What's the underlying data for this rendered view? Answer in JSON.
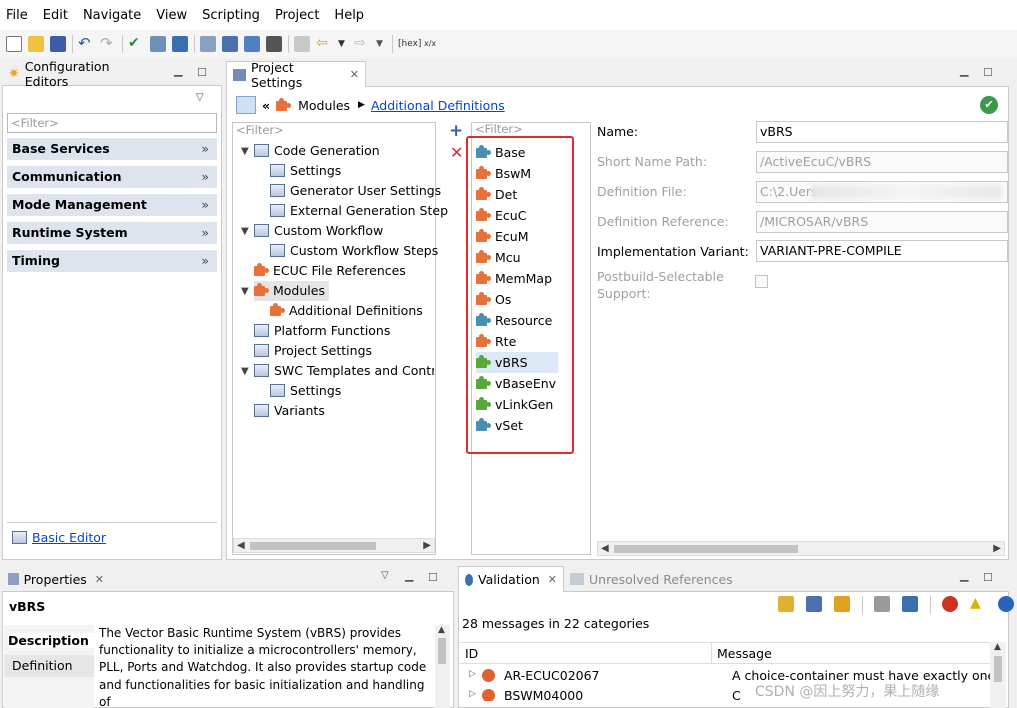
{
  "menu": [
    "File",
    "Edit",
    "Navigate",
    "View",
    "Scripting",
    "Project",
    "Help"
  ],
  "config_editors": {
    "title": "Configuration Editors",
    "filter_placeholder": "<Filter>",
    "categories": [
      "Base Services",
      "Communication",
      "Mode Management",
      "Runtime System",
      "Timing"
    ],
    "basic_editor_link": "Basic Editor"
  },
  "project_settings": {
    "tab_title": "Project Settings",
    "breadcrumb_modules": "Modules",
    "breadcrumb_link": "Additional Definitions",
    "tree_filter": "<Filter>",
    "tree": [
      "Code Generation",
      "Settings",
      "Generator User Settings",
      "External Generation Step",
      "Custom Workflow",
      "Custom Workflow Steps",
      "ECUC File References",
      "Modules",
      "Additional Definitions",
      "Platform Functions",
      "Project Settings",
      "SWC Templates and Contra",
      "Settings",
      "Variants"
    ],
    "modules_filter": "<Filter>",
    "modules": [
      {
        "name": "Base",
        "color": "#4a8fb0"
      },
      {
        "name": "BswM",
        "color": "#e8703a"
      },
      {
        "name": "Det",
        "color": "#e8703a"
      },
      {
        "name": "EcuC",
        "color": "#e8703a"
      },
      {
        "name": "EcuM",
        "color": "#e8703a"
      },
      {
        "name": "Mcu",
        "color": "#e8703a"
      },
      {
        "name": "MemMap",
        "color": "#e8703a"
      },
      {
        "name": "Os",
        "color": "#e8703a"
      },
      {
        "name": "Resource",
        "color": "#4a8fb0"
      },
      {
        "name": "Rte",
        "color": "#e8703a"
      },
      {
        "name": "vBRS",
        "color": "#5aa83a"
      },
      {
        "name": "vBaseEnv",
        "color": "#5aa83a"
      },
      {
        "name": "vLinkGen",
        "color": "#5aa83a"
      },
      {
        "name": "vSet",
        "color": "#4a8fb0"
      }
    ],
    "details": {
      "name_label": "Name:",
      "name_value": "vBRS",
      "short_name_label": "Short Name Path:",
      "short_name_value": "/ActiveEcuC/vBRS",
      "def_file_label": "Definition File:",
      "def_file_value": "C:\\2.Uers",
      "def_ref_label": "Definition Reference:",
      "def_ref_value": "/MICROSAR/vBRS",
      "impl_label": "Implementation Variant:",
      "impl_value": "VARIANT-PRE-COMPILE",
      "postbuild_label_1": "Postbuild-Selectable",
      "postbuild_label_2": "Support:"
    }
  },
  "properties": {
    "tab_title": "Properties",
    "title": "vBRS",
    "sections": [
      "Description",
      "Definition"
    ],
    "description": "The Vector Basic Runtime System (vBRS) provides functionality to initialize a microcontrollers' memory, PLL, Ports and Watchdog. It also provides startup code and functionalities for basic initialization and handling of"
  },
  "validation": {
    "tab_title": "Validation",
    "tab2_title": "Unresolved References",
    "summary": "28 messages in 22 categories",
    "col_id": "ID",
    "col_message": "Message",
    "rows": [
      {
        "id": "AR-ECUC02067",
        "message": "A choice-container must have exactly one ch"
      },
      {
        "id": "BSWM04000",
        "message": "C"
      }
    ]
  },
  "watermark": "CSDN @因上努力，果上随缘"
}
